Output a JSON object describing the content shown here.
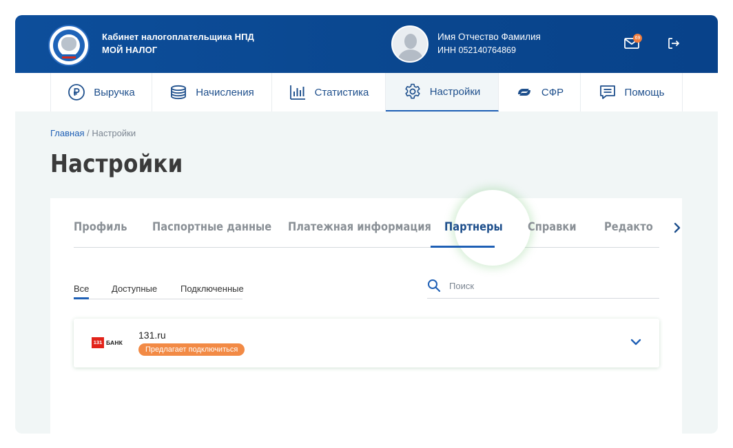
{
  "header": {
    "cabinet_title": "Кабинет налогоплательщика НПД",
    "app_name": "МОЙ НАЛОГ",
    "user_name": "Имя Отчество Фамилия",
    "user_inn": "ИНН 052140764869",
    "mail_count": "69",
    "brand_color": "#0a478f"
  },
  "nav": {
    "items": [
      {
        "label": "Выручка",
        "icon": "ruble-icon"
      },
      {
        "label": "Начисления",
        "icon": "coins-stack-icon"
      },
      {
        "label": "Статистика",
        "icon": "bar-chart-icon"
      },
      {
        "label": "Настройки",
        "icon": "gear-icon",
        "active": true
      },
      {
        "label": "СФР",
        "icon": "sfr-logo-icon"
      },
      {
        "label": "Помощь",
        "icon": "chat-help-icon"
      }
    ]
  },
  "breadcrumb": {
    "home": "Главная",
    "separator": "/",
    "current": "Настройки"
  },
  "page": {
    "title": "Настройки"
  },
  "settings_tabs": {
    "items": [
      "Профиль",
      "Паспортные данные",
      "Платежная информация",
      "Партнеры",
      "Справки",
      "Редакто"
    ],
    "active": "Партнеры"
  },
  "filters": {
    "items": [
      "Все",
      "Доступные",
      "Подключенные"
    ],
    "active": "Все"
  },
  "search": {
    "placeholder": "Поиск",
    "value": ""
  },
  "partners": [
    {
      "logo_number": "131",
      "logo_word": "БАНК",
      "name": "131.ru",
      "status": "Предлагает подключиться",
      "status_color": "#f28a45"
    }
  ]
}
